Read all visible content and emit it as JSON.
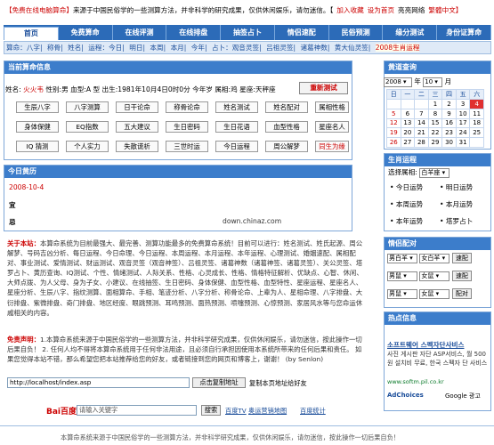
{
  "topbar": {
    "tag": "【免费在线电脑算命】",
    "notice": "来源于中国民俗学的一些测算方法，并非科学的研究成果，仅供休闲娱乐，请勿迷信。【",
    "links": [
      "加入收藏",
      "设为首页",
      "亮亮网络",
      "繁體中文"
    ],
    "end": "】"
  },
  "nav": {
    "tabs": [
      "首页",
      "免费算命",
      "在线评测",
      "在线排盘",
      "抽签占卜",
      "情侣速配",
      "民俗预测",
      "缘分测试",
      "身份证算命"
    ]
  },
  "subnav": {
    "items": [
      "算命：八字",
      "称骨",
      "姓名",
      "运程：今日",
      "明日",
      "本周",
      "本月",
      "今年",
      "占卜：观音灵签",
      "吕祖灵签",
      "诸葛神数",
      "黄大仙灵签"
    ],
    "highlight": "2008生肖运程"
  },
  "current_user": {
    "title": "当前算命信息",
    "name_label": "姓名:",
    "name": "火火韦",
    "gender_label": "性别:",
    "gender": "男",
    "blood_label": "血型:",
    "blood": "A 型",
    "birth_label": "出生:",
    "birth": "1981年10月4日0时0分",
    "age_label": "今年岁",
    "zodiac_label": "属相:",
    "zodiac": "鸡",
    "star_label": "星座:",
    "star": "天秤座",
    "reset_button": "重新测试"
  },
  "tests": {
    "rows": [
      [
        "生辰八字",
        "八字测算",
        "日干论命",
        "称骨论命",
        "姓名测试",
        "姓名配对",
        "属相性格"
      ],
      [
        "身体保健",
        "EQ指数",
        "五大建议",
        "生日密码",
        "生日花语",
        "血型性格",
        "星座名人"
      ],
      [
        "IQ 猜测",
        "个人实力",
        "失散谎析",
        "三世时运",
        "今日运程",
        "周公解梦",
        "同生为缘"
      ]
    ]
  },
  "calendar": {
    "title": "黄道查询",
    "year": "2008",
    "year_unit": "年",
    "month": "10",
    "month_unit": "月",
    "weekdays": [
      "日",
      "一",
      "二",
      "三",
      "四",
      "五",
      "六"
    ],
    "weeks": [
      [
        "",
        "",
        "",
        "1",
        "2",
        "3",
        "4"
      ],
      [
        "5",
        "6",
        "7",
        "8",
        "9",
        "10",
        "11"
      ],
      [
        "12",
        "13",
        "14",
        "15",
        "16",
        "17",
        "18"
      ],
      [
        "19",
        "20",
        "21",
        "22",
        "23",
        "24",
        "25"
      ],
      [
        "26",
        "27",
        "28",
        "29",
        "30",
        "31",
        ""
      ]
    ],
    "today": "4"
  },
  "almanac": {
    "title": "今日黄历",
    "date": "2008-10-4",
    "yi": "宜",
    "ji": "忌",
    "source": "down.chinaz.com"
  },
  "zodiac_fortune": {
    "title": "生肖运程",
    "select_label": "选择属相:",
    "select_value": "白羊座",
    "items": [
      "今日运势",
      "明日运势",
      "本周运势",
      "本月运势",
      "本年运势",
      "塔罗占卜"
    ]
  },
  "about": {
    "label": "关于本站：",
    "text": "本算命系统为目前最强大、最完善、测算功能最多的免费算命系统！目前可以进行：姓名测试、姓氏起源、周公解梦、号码吉凶分析、每日运程、今日命理、今日运程、本周运程、本月运程、本年运程、心理测试、婚姻速配、属相配对、事业测试、爱情测试、财运测试、观音灵签（观音神签）、吕祖灵签、诸葛神数（诸葛神签、诸葛灵签）、关公灵签、塔罗占卜、黄历查询、IQ测试、个性、情绪测试、人际关系、性格、心灵成长、性格、情格特征解析、优缺点、心智、休闲、大师点拨、为人父母、身为子女、小建议、在线抽签、生日密码、身体保健、血型性格、血型特性、星座运程、星座名人、星座分析、生辰八字、指纹测算、面相算命、手相、笔迹分析、八字分析、称骨论命、上辈为人、星相命理、八字排盘、大衍排盘、紫微排盘、奇门排盘、地区经度、眼跳预测、耳鸣预测、面热预测、喷嚏预测、心惊预测、家居风水等与您命运休戚相关的内容。"
  },
  "disclaimer": {
    "label": "免责声明：",
    "text": "1.本算命系统来源于中国民俗学的一些测算方法，并非科学研究成果，仅供休闲娱乐，请勿迷信，按此操作一切后果自负！ 2. 任何人均不得将本算命系统用于任何非法用途，且必须自行承担因使用本系统所带来的任何后果和责任。 如果您觉得本站不错，那么希望您把本站推荐给您的好友，或者链接到您的网页和博客上，谢谢！ (by Senlon)"
  },
  "address": {
    "value": "http://localhost/index.asp",
    "copy_button": "点击复制地址",
    "hint": "复制本页地址给好友"
  },
  "search": {
    "logo": "Bai百度",
    "placeholder": "请输入关键字",
    "button": "搜索",
    "links": [
      "百度TV",
      "奥运营销地图",
      "百度统计"
    ]
  },
  "couple": {
    "title": "情侣配对",
    "rows": [
      {
        "a": "男白羊",
        "b": "女白羊",
        "button": "速配"
      },
      {
        "a": "男鼠",
        "b": "女鼠",
        "button": "速配"
      },
      {
        "a": "男鼠",
        "b": "女鼠",
        "button": "配对"
      }
    ]
  },
  "ads": {
    "title": "热点信息",
    "headline": "소프트웨어 스펙자단사비스",
    "body": "사진 게시판 자단 ASP서비스, 월 500원 설치비 무료, 한국 스펙자 단 사비스",
    "url": "www.softm.pil.co.kr",
    "adchoices": "AdChoices",
    "google": "Google 광고"
  },
  "footer": {
    "text": "本算命系统来源于中国民俗学的一些测算方法，并非科学研究成果，仅供休闲娱乐，请勿迷信，按此操作一切后果自负！"
  },
  "colors": {
    "nav_blue": "#2c6bb8",
    "accent_red": "#c00"
  }
}
